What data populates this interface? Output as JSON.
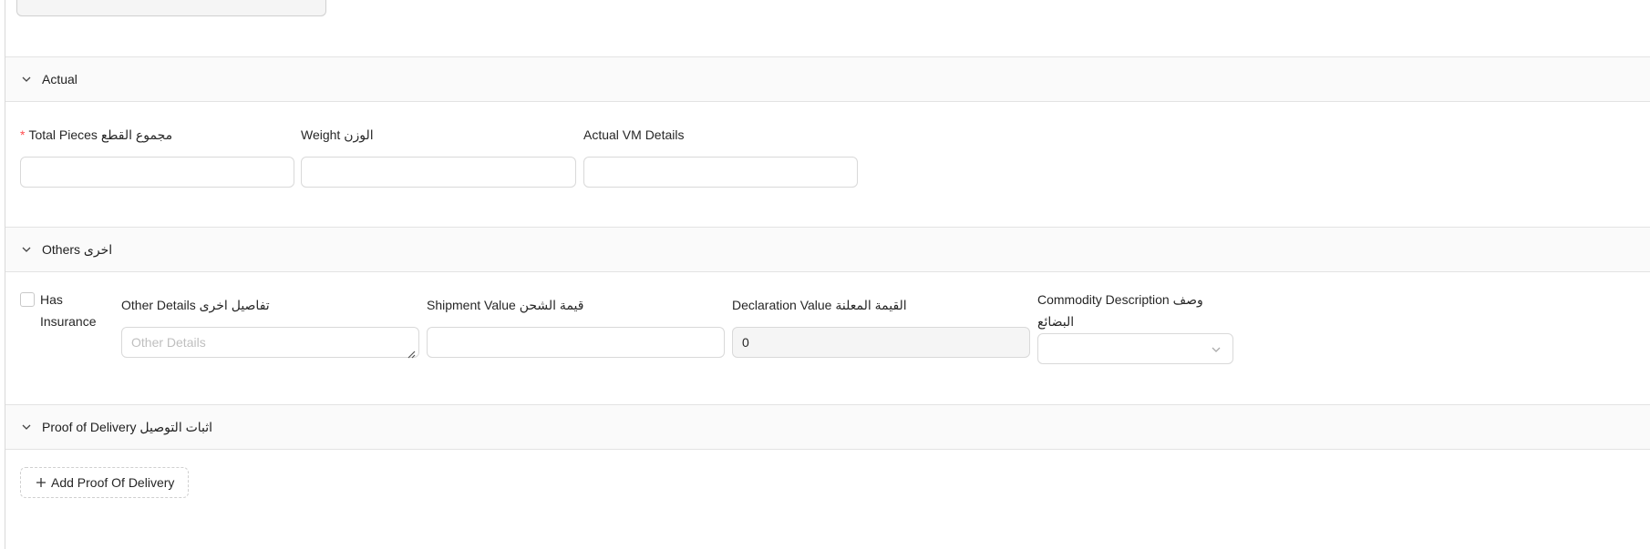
{
  "sections": {
    "actual": {
      "title": "Actual",
      "fields": {
        "total_pieces": {
          "label": "Total Pieces مجموع القطع",
          "required_mark": "*",
          "value": ""
        },
        "weight": {
          "label": "Weight الوزن",
          "value": ""
        },
        "actual_vm": {
          "label": "Actual VM Details",
          "value": ""
        }
      }
    },
    "others": {
      "title": "Others اخرى",
      "fields": {
        "has_insurance": {
          "label": "Has Insurance",
          "checked": false
        },
        "other_details": {
          "label": "Other Details تفاصيل اخرى",
          "placeholder": "Other Details",
          "value": ""
        },
        "shipment_value": {
          "label": "Shipment Value قيمة الشحن",
          "value": ""
        },
        "declaration_value": {
          "label": "Declaration Value القيمة المعلنة",
          "value": "0"
        },
        "commodity_description": {
          "label": "Commodity Description وصف البضائع",
          "value": ""
        }
      }
    },
    "proof": {
      "title": "Proof of Delivery اثبات التوصيل",
      "add_button": "Add Proof Of Delivery"
    }
  },
  "icons": {
    "chevron": "chevron-down-icon",
    "plus": "plus-icon",
    "select_arrow": "chevron-down-icon",
    "resize": "resize-grip-icon"
  },
  "colors": {
    "required": "#ff4d4f",
    "border": "#d9d9d9",
    "header_bg": "#fafafa",
    "disabled_bg": "#f5f5f5"
  }
}
